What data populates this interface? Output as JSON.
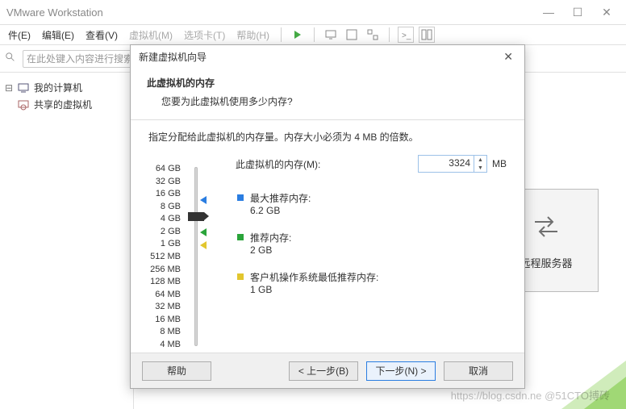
{
  "window": {
    "title": "VMware Workstation"
  },
  "menu": {
    "file": "件(E)",
    "edit": "编辑(E)",
    "view": "查看(V)",
    "vm": "虚拟机(M)",
    "tabs": "选项卡(T)",
    "help": "帮助(H)"
  },
  "search": {
    "placeholder": "在此处键入内容进行搜索"
  },
  "library": {
    "my_computer": "我的计算机",
    "shared_vms": "共享的虚拟机"
  },
  "remote_card": {
    "label": "远程服务器"
  },
  "watermark": "https://blog.csdn.ne  @51CTO搏砖",
  "dialog": {
    "title": "新建虚拟机向导",
    "heading": "此虚拟机的内存",
    "subheading": "您要为此虚拟机使用多少内存?",
    "instruction": "指定分配给此虚拟机的内存量。内存大小必须为 4 MB 的倍数。",
    "field_label": "此虚拟机的内存(M):",
    "value": "3324",
    "unit": "MB",
    "ticks": [
      "64 GB",
      "32 GB",
      "16 GB",
      "8 GB",
      "4 GB",
      "2 GB",
      "1 GB",
      "512 MB",
      "256 MB",
      "128 MB",
      "64 MB",
      "32 MB",
      "16 MB",
      "8 MB",
      "4 MB"
    ],
    "legend": {
      "max_label": "最大推荐内存:",
      "max_val": "6.2 GB",
      "rec_label": "推荐内存:",
      "rec_val": "2 GB",
      "min_label": "客户机操作系统最低推荐内存:",
      "min_val": "1 GB"
    },
    "buttons": {
      "help": "帮助",
      "back": "< 上一步(B)",
      "next": "下一步(N) >",
      "cancel": "取消"
    }
  }
}
